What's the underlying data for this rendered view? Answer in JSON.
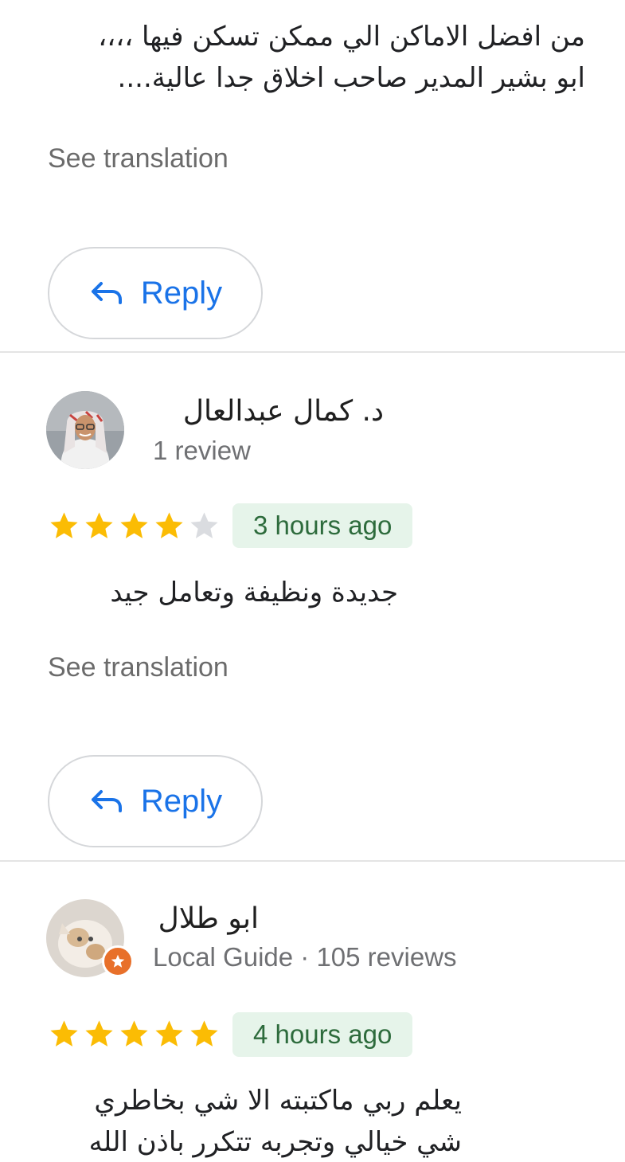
{
  "reviews": [
    {
      "text_lines": [
        "من افضل الاماكن الي ممكن تسكن فيها ،،،،",
        "ابو بشير المدير صاحب اخلاق جدا عالية...."
      ],
      "see_translation": "See translation",
      "reply_label": "Reply"
    },
    {
      "author": "د. كمال عبدالعال",
      "meta": "1 review",
      "rating": 4,
      "time": "3 hours ago",
      "text_lines": [
        "جديدة ونظيفة وتعامل جيد"
      ],
      "see_translation": "See translation",
      "reply_label": "Reply"
    },
    {
      "author": "ابو طلال",
      "meta": "Local Guide · 105 reviews",
      "rating": 5,
      "time": "4 hours ago",
      "text_lines": [
        "يعلم ربي ماكتبته الا شي بخاطري",
        "شي خيالي وتجربه تتكرر باذن الله"
      ]
    }
  ],
  "colors": {
    "accent": "#1a73e8",
    "star_filled": "#fbbc04",
    "star_empty": "#dadce0",
    "time_badge_bg": "#e6f4ea",
    "local_guide_badge": "#e8702a"
  },
  "icons": {
    "reply": "reply-arrow-icon",
    "star": "star-icon",
    "local_guide": "local-guide-badge-icon"
  }
}
